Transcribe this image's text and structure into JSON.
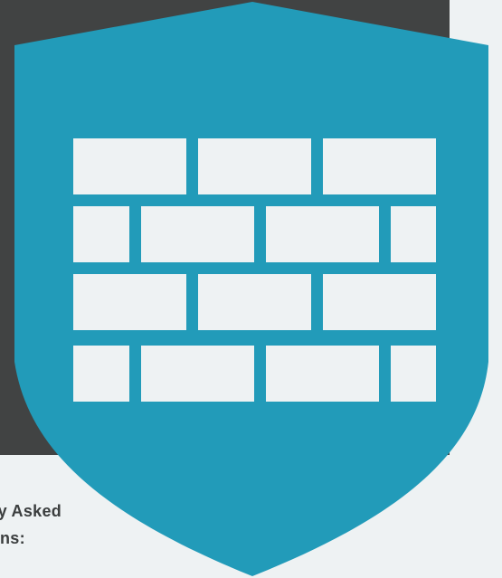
{
  "caption": {
    "line1": "tly Asked",
    "line2": "ns:"
  },
  "colors": {
    "background": "#eef2f3",
    "panel": "#414343",
    "shield": "#229bb9",
    "bricks": "#eef2f3",
    "caption_text": "#3b3e3e"
  },
  "icons": {
    "main": "firewall-shield-icon"
  }
}
